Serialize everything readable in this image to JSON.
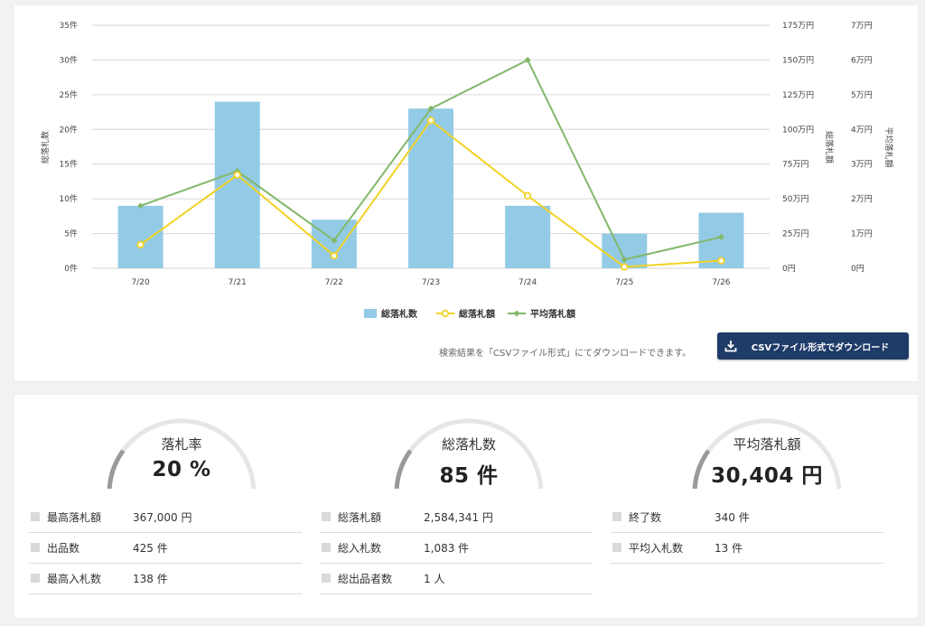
{
  "chart_data": {
    "type": "bar+line",
    "categories": [
      "7/20",
      "7/21",
      "7/22",
      "7/23",
      "7/24",
      "7/25",
      "7/26"
    ],
    "series": [
      {
        "name": "総落札数",
        "kind": "bar",
        "axis": "left",
        "color": "#93cbe6",
        "values": [
          9,
          24,
          7,
          23,
          9,
          5,
          8
        ]
      },
      {
        "name": "総落札額",
        "kind": "line",
        "axis": "right1",
        "color": "#f2d224",
        "marker": "hollow-circle",
        "values": [
          170000,
          672000,
          90000,
          1065000,
          522000,
          10000,
          55000
        ]
      },
      {
        "name": "平均落札額",
        "kind": "line",
        "axis": "right2",
        "color": "#82b86a",
        "marker": "diamond",
        "values": [
          18000,
          28000,
          8000,
          46000,
          60000,
          2500,
          9000
        ]
      }
    ],
    "y_left": {
      "label": "総落札数",
      "min": 0,
      "max": 35,
      "ticks": [
        "0件",
        "5件",
        "10件",
        "15件",
        "20件",
        "25件",
        "30件",
        "35件"
      ]
    },
    "y_right1": {
      "label": "総落札額",
      "min": 0,
      "max": 1750000,
      "ticks": [
        "0円",
        "25万円",
        "50万円",
        "75万円",
        "100万円",
        "125万円",
        "150万円",
        "175万円"
      ]
    },
    "y_right2": {
      "label": "平均落札額",
      "min": 0,
      "max": 70000,
      "ticks": [
        "0円",
        "1万円",
        "2万円",
        "3万円",
        "4万円",
        "5万円",
        "6万円",
        "7万円"
      ]
    },
    "grid": true,
    "legend": "bottom-center"
  },
  "download": {
    "note": "検索結果を「CSVファイル形式」にてダウンロードできます。",
    "button_label": "CSVファイル形式でダウンロード"
  },
  "stats": [
    {
      "gauge": {
        "title": "落札率",
        "value": "20 %"
      },
      "rows": [
        {
          "label": "最高落札額",
          "value": "367,000 円"
        },
        {
          "label": "出品数",
          "value": "425 件"
        },
        {
          "label": "最高入札数",
          "value": "138 件"
        }
      ]
    },
    {
      "gauge": {
        "title": "総落札数",
        "value": "85 件"
      },
      "rows": [
        {
          "label": "総落札額",
          "value": "2,584,341 円"
        },
        {
          "label": "総入札数",
          "value": "1,083 件"
        },
        {
          "label": "総出品者数",
          "value": "1 人"
        }
      ]
    },
    {
      "gauge": {
        "title": "平均落札額",
        "value": "30,404 円"
      },
      "rows": [
        {
          "label": "終了数",
          "value": "340 件"
        },
        {
          "label": "平均入札数",
          "value": "13 件"
        }
      ]
    }
  ],
  "colors": {
    "gauge_bg": "#e6e6e6",
    "gauge_fg": "#9a9a9a",
    "button": "#1f3b68"
  }
}
